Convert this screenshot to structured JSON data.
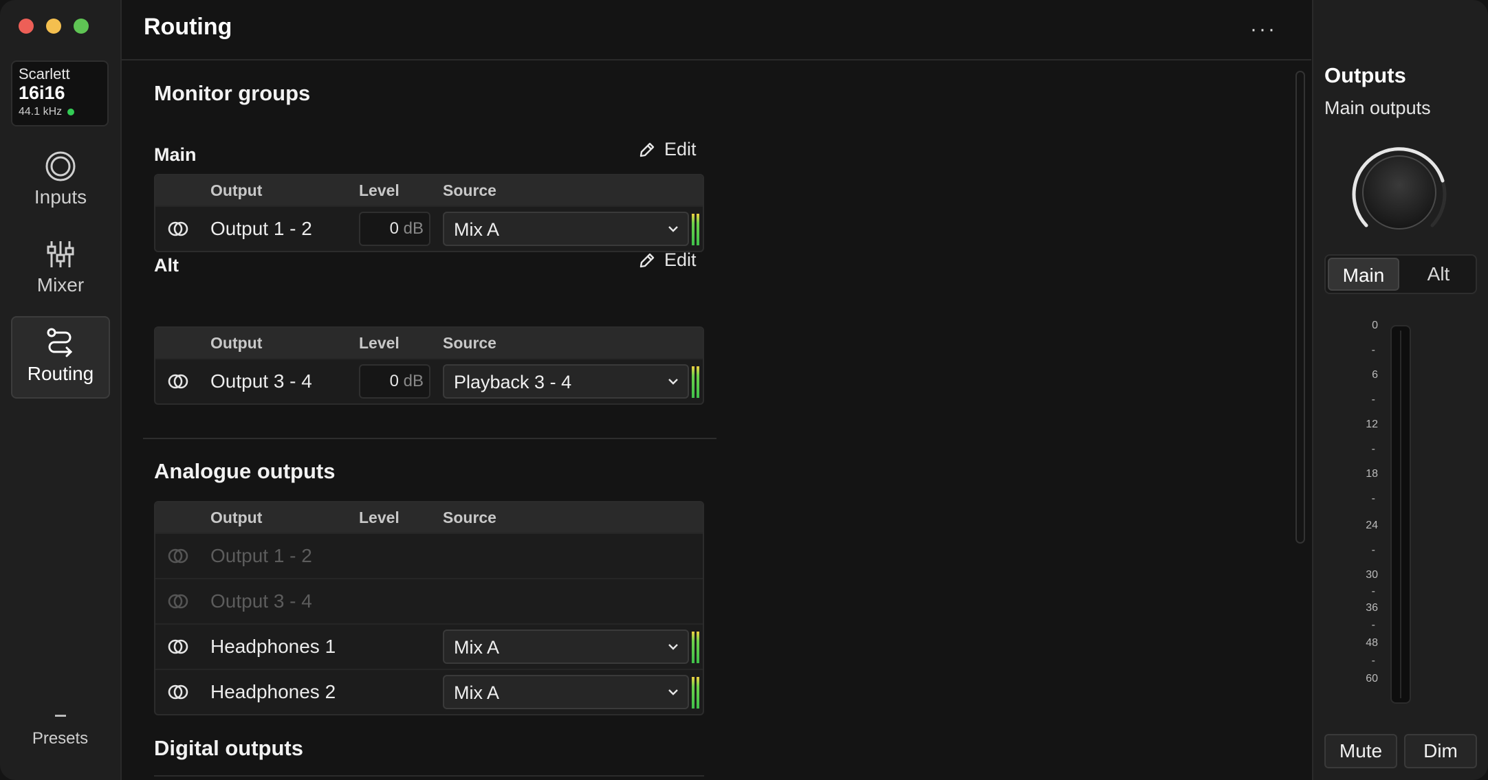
{
  "sidebar": {
    "device": {
      "brand": "Scarlett",
      "model": "16i16",
      "sample_rate": "44.1 kHz"
    },
    "nav": [
      {
        "label": "Inputs",
        "icon": "inputs-icon"
      },
      {
        "label": "Mixer",
        "icon": "mixer-icon"
      },
      {
        "label": "Routing",
        "icon": "routing-icon",
        "active": true
      }
    ],
    "presets_label": "Presets"
  },
  "header": {
    "title": "Routing",
    "more": "···"
  },
  "monitor_groups": {
    "title": "Monitor groups",
    "columns": {
      "output": "Output",
      "level": "Level",
      "source": "Source"
    },
    "edit_label": "Edit",
    "main": {
      "title": "Main",
      "rows": [
        {
          "output": "Output 1 - 2",
          "level": "0",
          "unit": "dB",
          "source": "Mix A"
        }
      ]
    },
    "alt": {
      "title": "Alt",
      "rows": [
        {
          "output": "Output 3 - 4",
          "level": "0",
          "unit": "dB",
          "source": "Playback 3 - 4"
        }
      ]
    }
  },
  "analogue_outputs": {
    "title": "Analogue outputs",
    "rows": [
      {
        "output": "Output 1 - 2",
        "disabled": true
      },
      {
        "output": "Output 3 - 4",
        "disabled": true
      },
      {
        "output": "Headphones 1",
        "source": "Mix A"
      },
      {
        "output": "Headphones 2",
        "source": "Mix A"
      }
    ]
  },
  "digital_outputs": {
    "title": "Digital outputs"
  },
  "outputs_panel": {
    "title": "Outputs",
    "subtitle": "Main outputs",
    "segment": {
      "main": "Main",
      "alt": "Alt",
      "selected": "Main"
    },
    "scale_labels": [
      "0",
      "6",
      "12",
      "18",
      "24",
      "30",
      "36",
      "48",
      "60"
    ],
    "minor_tick": "-",
    "mute_label": "Mute",
    "dim_label": "Dim"
  },
  "colors": {
    "background": "#141414",
    "sidebar": "#1f1f1f",
    "accent_green": "#33cc55",
    "traffic_red": "#ed5f57",
    "traffic_yellow": "#f4bf4f",
    "traffic_green": "#5fc454"
  }
}
